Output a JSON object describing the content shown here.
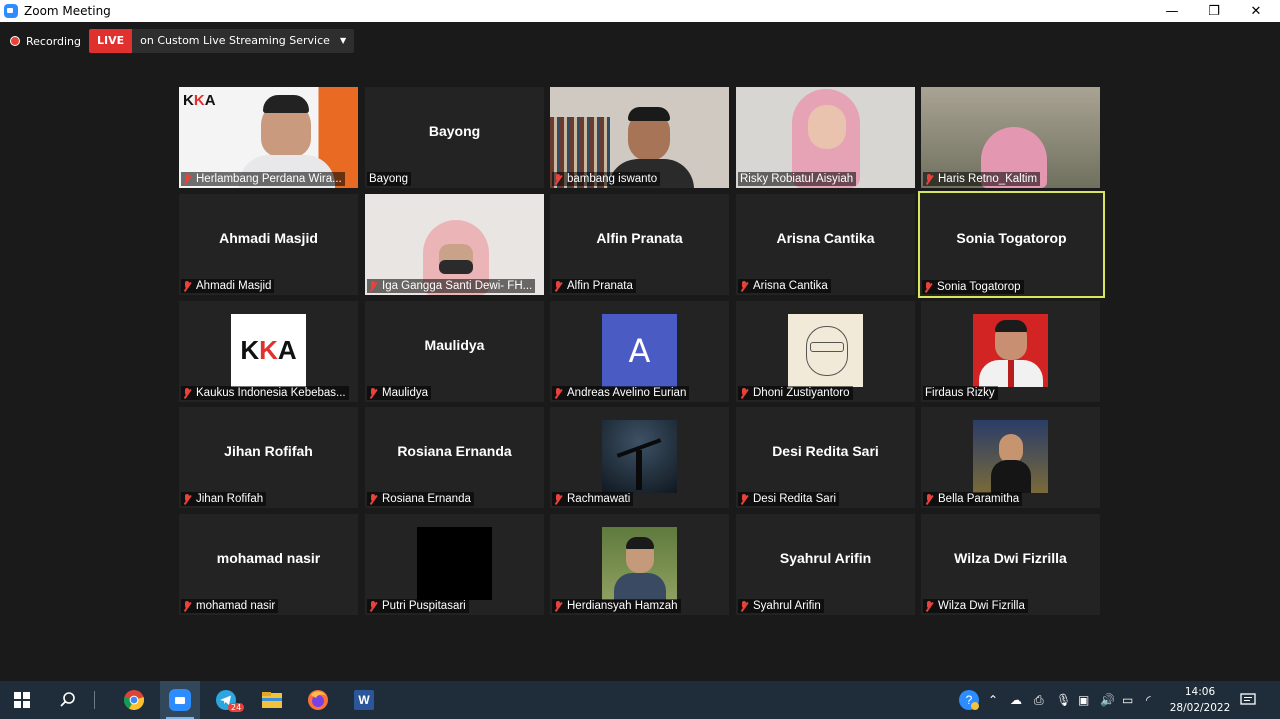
{
  "window": {
    "title": "Zoom Meeting",
    "controls": {
      "minimize": "—",
      "restore": "❐",
      "close": "✕"
    }
  },
  "recording": {
    "label": "Recording",
    "live_badge": "LIVE",
    "stream_service": "on Custom Live Streaming Service"
  },
  "participants": [
    {
      "name": "Herlambang Perdana Wira...",
      "muted": true,
      "view": "video-kka"
    },
    {
      "name": "Bayong",
      "muted": false,
      "view": "name",
      "display_name": "Bayong"
    },
    {
      "name": "bambang iswanto",
      "muted": true,
      "view": "video-man-shelf"
    },
    {
      "name": "Risky Robiatul Aisyiah",
      "muted": false,
      "view": "video-hijab-pink"
    },
    {
      "name": "Haris Retno_Kaltim",
      "muted": true,
      "view": "video-hijab-window"
    },
    {
      "name": "Ahmadi Masjid",
      "muted": true,
      "view": "name",
      "display_name": "Ahmadi Masjid"
    },
    {
      "name": "Iga Gangga Santi Dewi- FH...",
      "muted": true,
      "view": "video-hijab-mask"
    },
    {
      "name": "Alfin Pranata",
      "muted": true,
      "view": "name",
      "display_name": "Alfin Pranata"
    },
    {
      "name": "Arisna Cantika",
      "muted": true,
      "view": "name",
      "display_name": "Arisna Cantika"
    },
    {
      "name": "Sonia Togatorop",
      "muted": true,
      "view": "name",
      "display_name": "Sonia Togatorop",
      "active": true
    },
    {
      "name": "Kaukus Indonesia Kebebas...",
      "muted": true,
      "view": "avatar-kka"
    },
    {
      "name": "Maulidya",
      "muted": true,
      "view": "name",
      "display_name": "Maulidya"
    },
    {
      "name": "Andreas Avelino Eurian",
      "muted": true,
      "view": "avatar-letter",
      "avatar_letter": "A"
    },
    {
      "name": "Dhoni Zustiyantoro",
      "muted": true,
      "view": "avatar-sketch"
    },
    {
      "name": "Firdaus Rizky",
      "muted": false,
      "view": "avatar-red"
    },
    {
      "name": "Jihan Rofifah",
      "muted": true,
      "view": "name",
      "display_name": "Jihan Rofifah"
    },
    {
      "name": "Rosiana Ernanda",
      "muted": true,
      "view": "name",
      "display_name": "Rosiana Ernanda"
    },
    {
      "name": "Rachmawati",
      "muted": true,
      "view": "avatar-night"
    },
    {
      "name": "Desi Redita Sari",
      "muted": true,
      "view": "name",
      "display_name": "Desi Redita Sari"
    },
    {
      "name": "Bella Paramitha",
      "muted": true,
      "view": "avatar-lights"
    },
    {
      "name": "mohamad nasir",
      "muted": true,
      "view": "name",
      "display_name": "mohamad nasir"
    },
    {
      "name": "Putri Puspitasari",
      "muted": true,
      "view": "avatar-black"
    },
    {
      "name": "Herdiansyah Hamzah",
      "muted": true,
      "view": "avatar-outdoor"
    },
    {
      "name": "Syahrul Arifin",
      "muted": true,
      "view": "name",
      "display_name": "Syahrul Arifin"
    },
    {
      "name": "Wilza Dwi Fizrilla",
      "muted": true,
      "view": "name",
      "display_name": "Wilza Dwi Fizrilla"
    }
  ],
  "logo_text": "KKA",
  "taskbar": {
    "apps": [
      "windows-start",
      "search",
      "chrome",
      "zoom",
      "telegram",
      "file-explorer",
      "firefox",
      "word"
    ],
    "telegram_badge": "24",
    "word_label": "W",
    "clock": {
      "time": "14:06",
      "date": "28/02/2022"
    }
  },
  "colors": {
    "background": "#1a1a1a",
    "tile": "#232323",
    "live_red": "#e0312f",
    "active_speaker": "#d8e55e",
    "taskbar": "#1f2d3a"
  }
}
